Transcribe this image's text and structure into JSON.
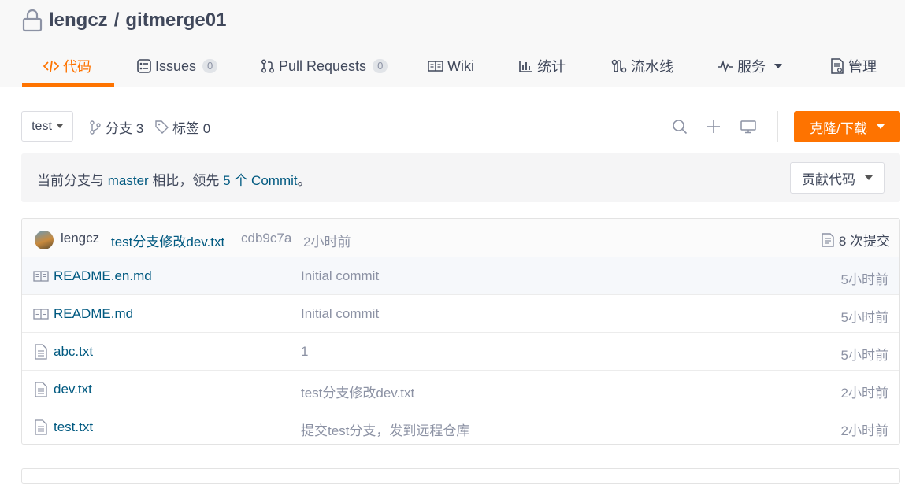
{
  "repo": {
    "owner": "lengcz",
    "separator": "/",
    "name": "gitmerge01"
  },
  "tabs": [
    {
      "label": "代码",
      "icon": "code-icon"
    },
    {
      "label": "Issues",
      "count": "0",
      "icon": "issues-icon"
    },
    {
      "label": "Pull Requests",
      "count": "0",
      "icon": "pull-request-icon"
    },
    {
      "label": "Wiki",
      "icon": "wiki-icon"
    },
    {
      "label": "统计",
      "icon": "stats-icon"
    },
    {
      "label": "流水线",
      "icon": "pipeline-icon"
    },
    {
      "label": "服务",
      "icon": "service-icon"
    },
    {
      "label": "管理",
      "icon": "settings-doc-icon"
    }
  ],
  "toolbar": {
    "branch": "test",
    "branches_label": "分支 3",
    "tags_label": "标签 0",
    "clone_label": "克隆/下载"
  },
  "compare": {
    "prefix": "当前分支与 ",
    "base_branch": "master",
    "middle": " 相比，领先 ",
    "ahead_count": "5 个 Commit",
    "suffix": "。",
    "contribute_label": "贡献代码"
  },
  "last_commit": {
    "author": "lengcz",
    "message": "test分支修改dev.txt",
    "sha": "cdb9c7a",
    "time": "2小时前",
    "commit_count": "8 次提交"
  },
  "files": [
    {
      "name": "README.en.md",
      "message": "Initial commit",
      "time": "5小时前",
      "icon": "readme-book-icon"
    },
    {
      "name": "README.md",
      "message": "Initial commit",
      "time": "5小时前",
      "icon": "readme-book-icon"
    },
    {
      "name": "abc.txt",
      "message": "1",
      "time": "5小时前",
      "icon": "file-icon"
    },
    {
      "name": "dev.txt",
      "message": "test分支修改dev.txt",
      "time": "2小时前",
      "icon": "file-icon"
    },
    {
      "name": "test.txt",
      "message": "提交test分支，发到远程仓库",
      "time": "2小时前",
      "icon": "file-icon"
    }
  ],
  "colors": {
    "accent": "#fe7300",
    "link": "#005980",
    "muted": "#8c92a4",
    "text": "#40485b"
  }
}
